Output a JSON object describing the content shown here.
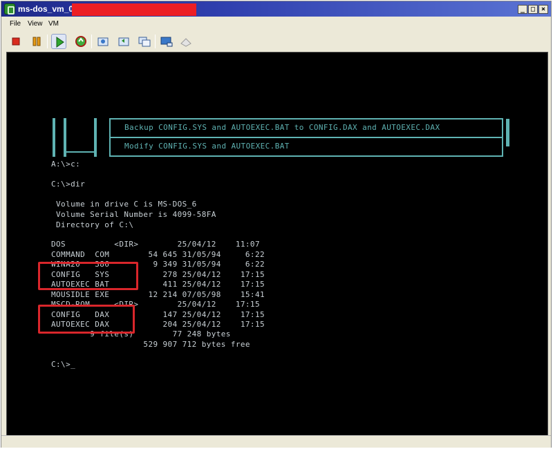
{
  "window": {
    "title": "ms-dos_vm_0"
  },
  "menu": {
    "items": [
      "File",
      "View",
      "VM"
    ]
  },
  "toolbar": {
    "buttons": [
      "power-off-icon",
      "suspend-icon",
      "power-on-icon",
      "reset-icon",
      "snapshot-icon",
      "revert-snapshot-icon",
      "snapshot-manager-icon",
      "console-icon",
      "fullscreen-icon"
    ]
  },
  "dos_menu": {
    "item1": "Backup CONFIG.SYS and AUTOEXEC.BAT to CONFIG.DAX and AUTOEXEC.DAX",
    "item2": "Modify CONFIG.SYS and AUTOEXEC.BAT"
  },
  "console": {
    "lines": [
      "A:\\>c:",
      "C:\\>dir",
      " Volume in drive C is MS-DOS_6",
      " Volume Serial Number is 4099-58FA",
      " Directory of C:\\",
      "DOS          <DIR>        25/04/12    11:07",
      "COMMAND  COM        54 645 31/05/94     6:22",
      "WINA20   386         9 349 31/05/94     6:22",
      "CONFIG   SYS           278 25/04/12    17:15",
      "AUTOEXEC BAT           411 25/04/12    17:15",
      "MOUSIDLE EXE        12 214 07/05/98    15:41",
      "MSCD-ROM     <DIR>        25/04/12    17:15",
      "CONFIG   DAX           147 25/04/12    17:15",
      "AUTOEXEC DAX           204 25/04/12    17:15",
      "        9 file(s)        77 248 bytes",
      "                   529 907 712 bytes free",
      "C:\\>_"
    ]
  },
  "colors": {
    "highlight": "#d9262b",
    "menu_cyan": "#5fb3b3",
    "redaction": "#ec1e24"
  }
}
